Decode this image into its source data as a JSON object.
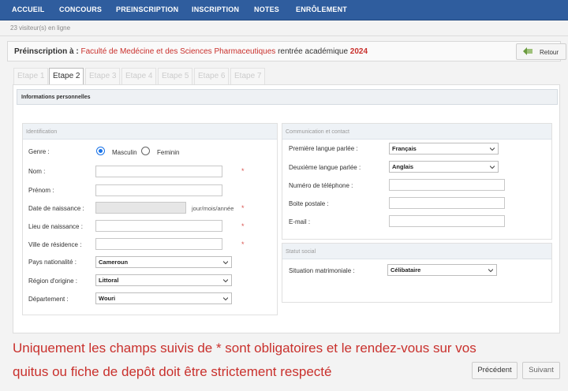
{
  "nav": {
    "items": [
      "ACCUEIL",
      "CONCOURS",
      "PREINSCRIPTION",
      "INSCRIPTION",
      "NOTES",
      "ENRÔLEMENT"
    ]
  },
  "visitors": "23 visiteur(s) en ligne",
  "header": {
    "prefix": "Préinscription à :",
    "faculty": "Faculté de Medécine et des Sciences Pharmaceutiques",
    "middle": "rentrée académique",
    "year": "2024",
    "back_label": "Retour"
  },
  "tabs": [
    "Etape 1",
    "Etape 2",
    "Etape 3",
    "Etape 4",
    "Etape 5",
    "Etape 6",
    "Etape 7"
  ],
  "active_tab": "Etape 2",
  "section_title": "Informations personnelles",
  "identification": {
    "title": "Identification",
    "genre_label": "Genre :",
    "genre_options": [
      "Masculin",
      "Feminin"
    ],
    "genre_selected": "Masculin",
    "nom_label": "Nom :",
    "prenom_label": "Prénom :",
    "naissance_label": "Date de naissance :",
    "naissance_hint": "jour/mois/année",
    "lieu_label": "Lieu de naissance :",
    "ville_label": "Ville de résidence :",
    "pays_label": "Pays nationalité :",
    "pays_value": "Cameroun",
    "region_label": "Région d'origine :",
    "region_value": "Littoral",
    "departement_label": "Département :",
    "departement_value": "Wouri",
    "required_mark": "*"
  },
  "contact": {
    "title": "Communication et contact",
    "langue1_label": "Première langue parlée :",
    "langue1_value": "Français",
    "langue2_label": "Deuxième langue parlée :",
    "langue2_value": "Anglais",
    "tel_label": "Numéro de téléphone :",
    "boite_label": "Boite postale :",
    "email_label": "E-mail :"
  },
  "statut": {
    "title": "Statut social",
    "situation_label": "Situation matrimoniale :",
    "situation_value": "Célibataire"
  },
  "notice": {
    "line1": "Uniquement les champs suivis de * sont obligatoires et le rendez-vous sur vos",
    "line2": "quitus ou fiche de depôt doit être strictement respecté"
  },
  "buttons": {
    "previous": "Précédent",
    "next": "Suivant"
  },
  "colors": {
    "navbar": "#2f5d9e",
    "accent_red": "#c9302c",
    "radio_blue": "#1a73e8"
  }
}
